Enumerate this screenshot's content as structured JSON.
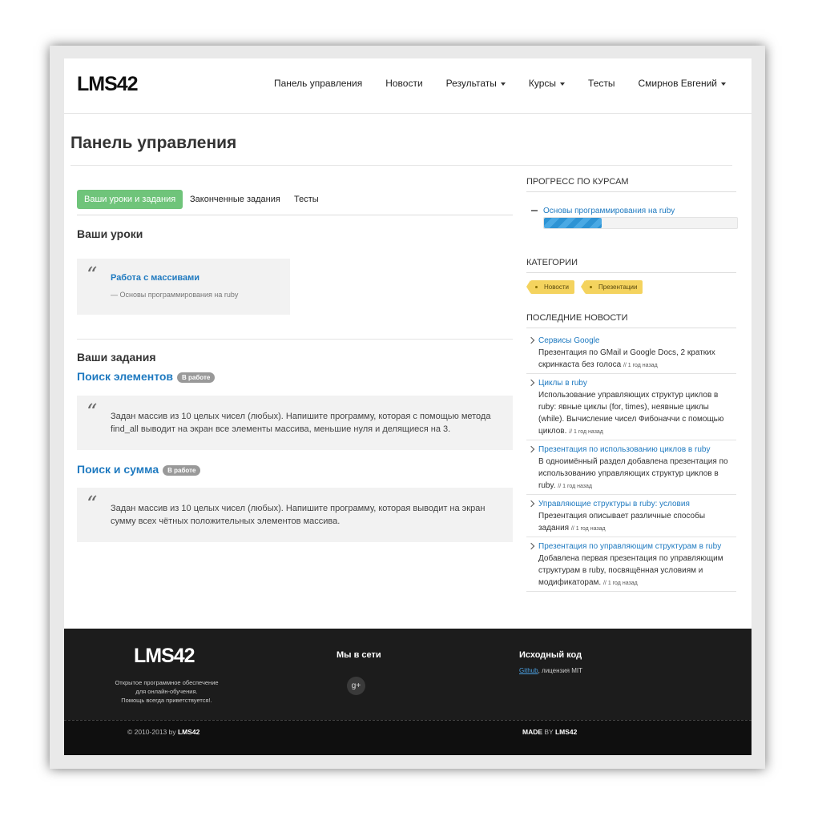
{
  "header": {
    "logo": "LMS42",
    "nav": [
      {
        "label": "Панель управления",
        "dropdown": false
      },
      {
        "label": "Новости",
        "dropdown": false
      },
      {
        "label": "Результаты",
        "dropdown": true
      },
      {
        "label": "Курсы",
        "dropdown": true
      },
      {
        "label": "Тесты",
        "dropdown": false
      },
      {
        "label": "Смирнов Евгений",
        "dropdown": true
      }
    ]
  },
  "page_title": "Панель управления",
  "tabs": [
    {
      "label": "Ваши уроки и задания",
      "active": true
    },
    {
      "label": "Законченные задания",
      "active": false
    },
    {
      "label": "Тесты",
      "active": false
    }
  ],
  "lessons": {
    "heading": "Ваши уроки",
    "items": [
      {
        "title": "Работа с массивами",
        "course": "— Основы программирования на ruby"
      }
    ]
  },
  "tasks": {
    "heading": "Ваши задания",
    "items": [
      {
        "title": "Поиск элементов",
        "badge": "В работе",
        "text": "Задан массив из 10 целых чисел (любых). Напишите программу, которая с помощью метода find_all выводит на экран все элементы массива, меньшие нуля и делящиеся на 3."
      },
      {
        "title": "Поиск и сумма",
        "badge": "В работе",
        "text": "Задан массив из 10 целых чисел (любых). Напишите программу, которая выводит на экран сумму всех чётных положительных элементов массива."
      }
    ]
  },
  "sidebar": {
    "progress_heading": "ПРОГРЕСС ПО КУРСАМ",
    "progress": [
      {
        "course": "Основы программирования на ruby",
        "fraction": 0.3
      }
    ],
    "categories_heading": "КАТЕГОРИИ",
    "categories": [
      "Новости",
      "Презентации"
    ],
    "news_heading": "ПОСЛЕДНИЕ НОВОСТИ",
    "news": [
      {
        "title": "Сервисы Google",
        "text": "Презентация по GMail и Google Docs, 2 кратких скринкаста без голоса",
        "time": "// 1 год назад"
      },
      {
        "title": "Циклы в ruby",
        "text": "Использование управляющих структур циклов в ruby: явные циклы (for, times), неявные циклы (while). Вычисление чисел Фибоначчи с помощью циклов.",
        "time": "// 1 год назад"
      },
      {
        "title": "Презентация по использованию циклов в ruby",
        "text": "В одноимённый раздел добавлена презентация по использованию управляющих структур циклов в ruby.",
        "time": "// 1 год назад"
      },
      {
        "title": "Управляющие структуры в ruby: условия",
        "text": "Презентация описывает различные способы задания",
        "time": "// 1 год назад"
      },
      {
        "title": "Презентация по управляющим структурам в ruby",
        "text": "Добавлена первая презентация по управляющим структурам в ruby, посвящённая условиям и модификаторам.",
        "time": "// 1 год назад"
      }
    ]
  },
  "footer": {
    "logo": "LMS42",
    "desc_lines": [
      "Открытое программное обеспечение",
      "для онлайн-обучения.",
      "Помощь всегда приветствуется!."
    ],
    "social_heading": "Мы в сети",
    "social_icon": "g+",
    "source_heading": "Исходный код",
    "source_link": "Github",
    "source_license": ", лицензия MIT",
    "copyright_prefix": "© 2010-2013 by ",
    "copyright_brand": "LMS42",
    "made_prefix": "MADE",
    "made_by": " BY ",
    "made_brand": "LMS42"
  }
}
